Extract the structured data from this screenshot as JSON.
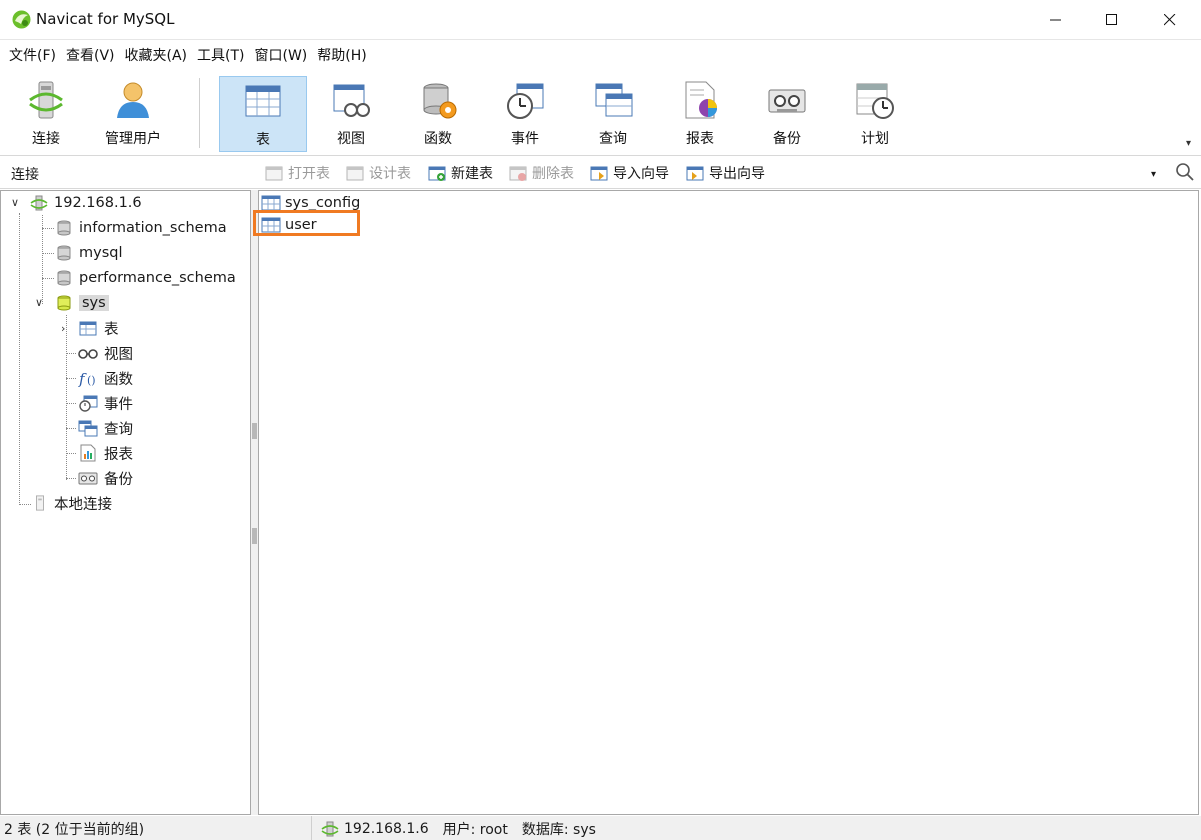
{
  "window": {
    "title": "Navicat for MySQL",
    "controls": [
      "minimize",
      "maximize",
      "close"
    ]
  },
  "menu": {
    "items": [
      "文件(F)",
      "查看(V)",
      "收藏夹(A)",
      "工具(T)",
      "窗口(W)",
      "帮助(H)"
    ]
  },
  "toolbar": {
    "items": [
      {
        "label": "连接",
        "icon": "connect-icon"
      },
      {
        "label": "管理用户",
        "icon": "user-icon"
      },
      {
        "label": "表",
        "icon": "table-icon",
        "active": true
      },
      {
        "label": "视图",
        "icon": "view-icon"
      },
      {
        "label": "函数",
        "icon": "function-icon"
      },
      {
        "label": "事件",
        "icon": "event-icon"
      },
      {
        "label": "查询",
        "icon": "query-icon"
      },
      {
        "label": "报表",
        "icon": "report-icon"
      },
      {
        "label": "备份",
        "icon": "backup-icon"
      },
      {
        "label": "计划",
        "icon": "schedule-icon"
      }
    ]
  },
  "subbar": {
    "connection_title": "连接",
    "actions": [
      {
        "label": "打开表",
        "enabled": false
      },
      {
        "label": "设计表",
        "enabled": false
      },
      {
        "label": "新建表",
        "enabled": true
      },
      {
        "label": "删除表",
        "enabled": false
      },
      {
        "label": "导入向导",
        "enabled": true
      },
      {
        "label": "导出向导",
        "enabled": true
      }
    ]
  },
  "tree": {
    "connection": "192.168.1.6",
    "databases": [
      "information_schema",
      "mysql",
      "performance_schema",
      "sys"
    ],
    "selected_db": "sys",
    "db_children": [
      "表",
      "视图",
      "函数",
      "事件",
      "查询",
      "报表",
      "备份"
    ],
    "local_connection": "本地连接"
  },
  "objects": {
    "items": [
      "sys_config",
      "user"
    ],
    "highlighted": "user"
  },
  "status": {
    "left": "2 表 (2 位于当前的组)",
    "host": "192.168.1.6",
    "user": "用户: root",
    "database": "数据库: sys"
  },
  "colors": {
    "accent_active": "#cce4f7",
    "highlight": "#f07a22"
  }
}
